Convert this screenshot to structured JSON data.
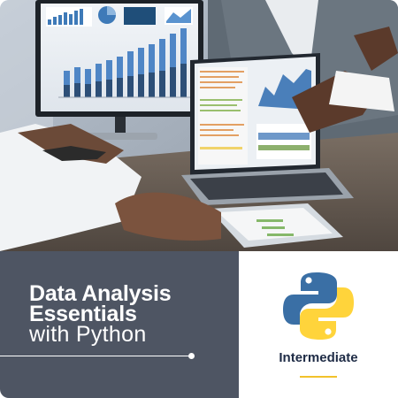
{
  "course": {
    "title_line1": "Data Analysis",
    "title_line2": "Essentials",
    "title_line3": "with Python",
    "level": "Intermediate"
  },
  "icons": {
    "logo": "python-logo"
  },
  "colors": {
    "panel_background": "#4e5563",
    "title_text": "#ffffff",
    "level_text": "#1e2b45",
    "accent": "#f2c22b",
    "python_blue": "#3a6fa5",
    "python_yellow": "#ffd43b"
  }
}
